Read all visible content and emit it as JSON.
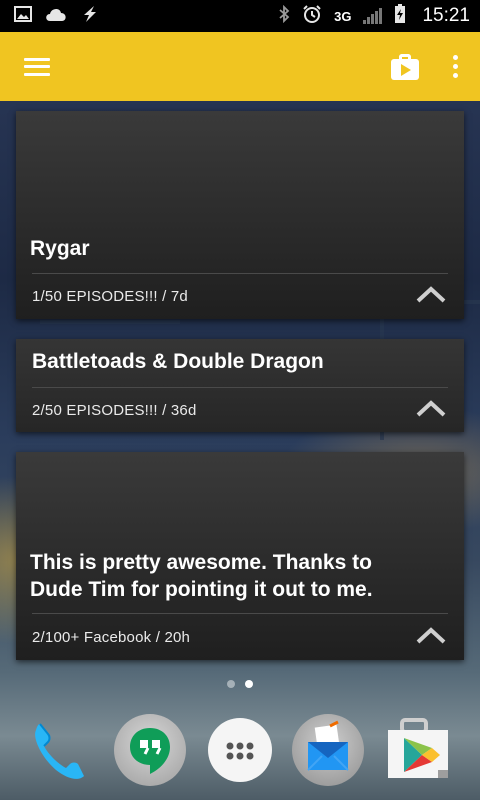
{
  "status_bar": {
    "time": "15:21",
    "network": "3G",
    "left_icons": [
      "image-icon",
      "cloud-icon",
      "flash-icon"
    ],
    "right_icons": [
      "bluetooth-icon",
      "alarm-icon",
      "signal-icon",
      "battery-icon"
    ]
  },
  "app_bar": {
    "color": "#f0c521",
    "icons": [
      "menu-icon",
      "play-store-icon",
      "overflow-menu-icon"
    ]
  },
  "cards": [
    {
      "title": "Rygar",
      "meta": "1/50  EPISODES!!! / 7d"
    },
    {
      "title": "Battletoads & Double Dragon",
      "meta": "2/50  EPISODES!!! / 36d"
    },
    {
      "title": "This is pretty awesome. Thanks to Dude Tim for pointing it out to me.",
      "meta": "2/100+  Facebook / 20h"
    }
  ],
  "home_pages": {
    "count": 2,
    "active": 2
  },
  "dock": [
    "phone-icon",
    "hangouts-icon",
    "app-drawer-icon",
    "email-icon",
    "play-store-icon"
  ]
}
